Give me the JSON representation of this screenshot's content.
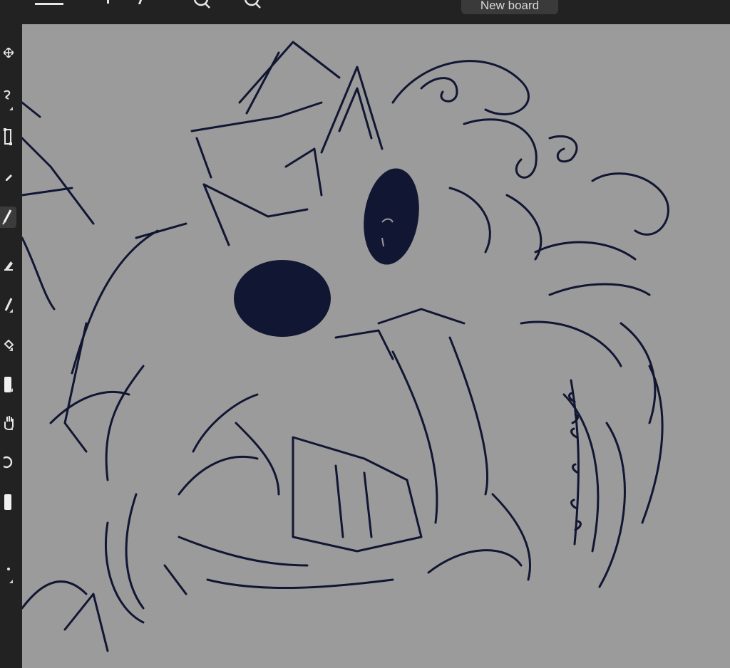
{
  "topbar": {
    "new_board_label": "New board"
  },
  "toolbar": {
    "tools": [
      "move-tool",
      "lasso-tool",
      "transform-tool",
      "fill-tool",
      "brush-tool",
      "eraser-tool",
      "pen-tool",
      "gradient-tool",
      "shape-tool",
      "hand-tool",
      "rotate-tool",
      "color-swatch",
      "more-tool"
    ],
    "active_tool": "brush-tool"
  },
  "colors": {
    "canvas_bg": "#9b9b9b",
    "ink": "#111633",
    "chrome": "#222222"
  }
}
